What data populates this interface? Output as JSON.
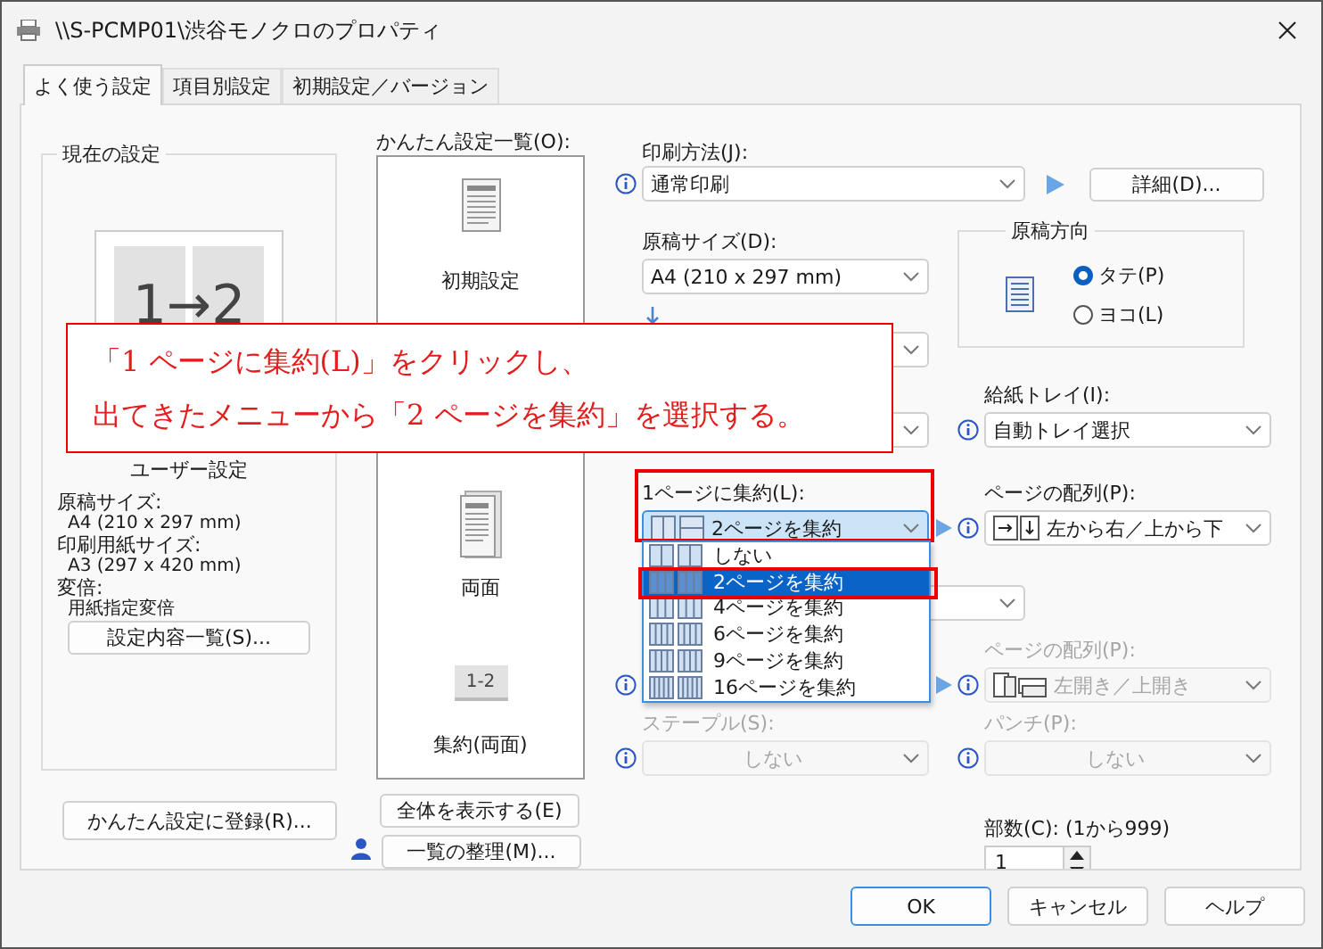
{
  "window": {
    "title": "\\\\S-PCMP01\\渋谷モノクロのプロパティ"
  },
  "tabs": [
    {
      "label": "よく使う設定",
      "selected": true
    },
    {
      "label": "項目別設定",
      "selected": false
    },
    {
      "label": "初期設定／バージョン",
      "selected": false
    }
  ],
  "current_settings": {
    "title": "現在の設定",
    "preview_text": "1→2",
    "caption": "ユーザー設定",
    "details": [
      {
        "label": "原稿サイズ:",
        "value": "A4 (210 x 297 mm)"
      },
      {
        "label": "印刷用紙サイズ:",
        "value": "A3 (297 x 420 mm)"
      },
      {
        "label": "変倍:",
        "value": "用紙指定変倍"
      }
    ],
    "button": "設定内容一覧(S)..."
  },
  "register_button": "かんたん設定に登録(R)...",
  "easy_settings": {
    "label": "かんたん設定一覧(O):",
    "items": [
      {
        "label": "初期設定",
        "kind": "document"
      },
      {
        "label": "両面",
        "kind": "duplex"
      },
      {
        "label": "集約(両面)",
        "kind": "nup",
        "icon_text": "1-2"
      }
    ],
    "show_all_button": "全体を表示する(E)",
    "organize_button": "一覧の整理(M)..."
  },
  "print_method": {
    "label": "印刷方法(J):",
    "value": "通常印刷",
    "details_button": "詳細(D)..."
  },
  "original_size": {
    "label": "原稿サイズ(D):",
    "value": "A4 (210 x 297 mm)"
  },
  "orientation": {
    "title": "原稿方向",
    "options": [
      {
        "label": "タテ(P)",
        "selected": true
      },
      {
        "label": "ヨコ(L)",
        "selected": false
      }
    ]
  },
  "paper_tray": {
    "label": "給紙トレイ(I):",
    "value": "自動トレイ選択"
  },
  "nup": {
    "label": "1ページに集約(L):",
    "value": "2ページを集約",
    "open": true,
    "options": [
      {
        "label": "しない",
        "selected": false
      },
      {
        "label": "2ページを集約",
        "selected": true
      },
      {
        "label": "4ページを集約",
        "selected": false
      },
      {
        "label": "6ページを集約",
        "selected": false
      },
      {
        "label": "9ページを集約",
        "selected": false
      },
      {
        "label": "16ページを集約",
        "selected": false
      }
    ]
  },
  "page_order": {
    "label": "ページの配列(P):",
    "value": "左から右／上から下",
    "disabled": false
  },
  "binding": {
    "label": "ページの配列(P):",
    "value": "左開き／上開き",
    "disabled": true
  },
  "staple": {
    "label": "ステープル(S):",
    "value": "しない",
    "disabled": true
  },
  "punch": {
    "label": "パンチ(P):",
    "value": "しない",
    "disabled": true
  },
  "copies": {
    "label": "部数(C): (1から999)",
    "value": "1"
  },
  "callout": {
    "lines": [
      "「1 ページに集約(L)」をクリックし、",
      "出てきたメニューから「2 ページを集約」を選択する。"
    ]
  },
  "buttons": [
    "OK",
    "キャンセル",
    "ヘルプ"
  ]
}
